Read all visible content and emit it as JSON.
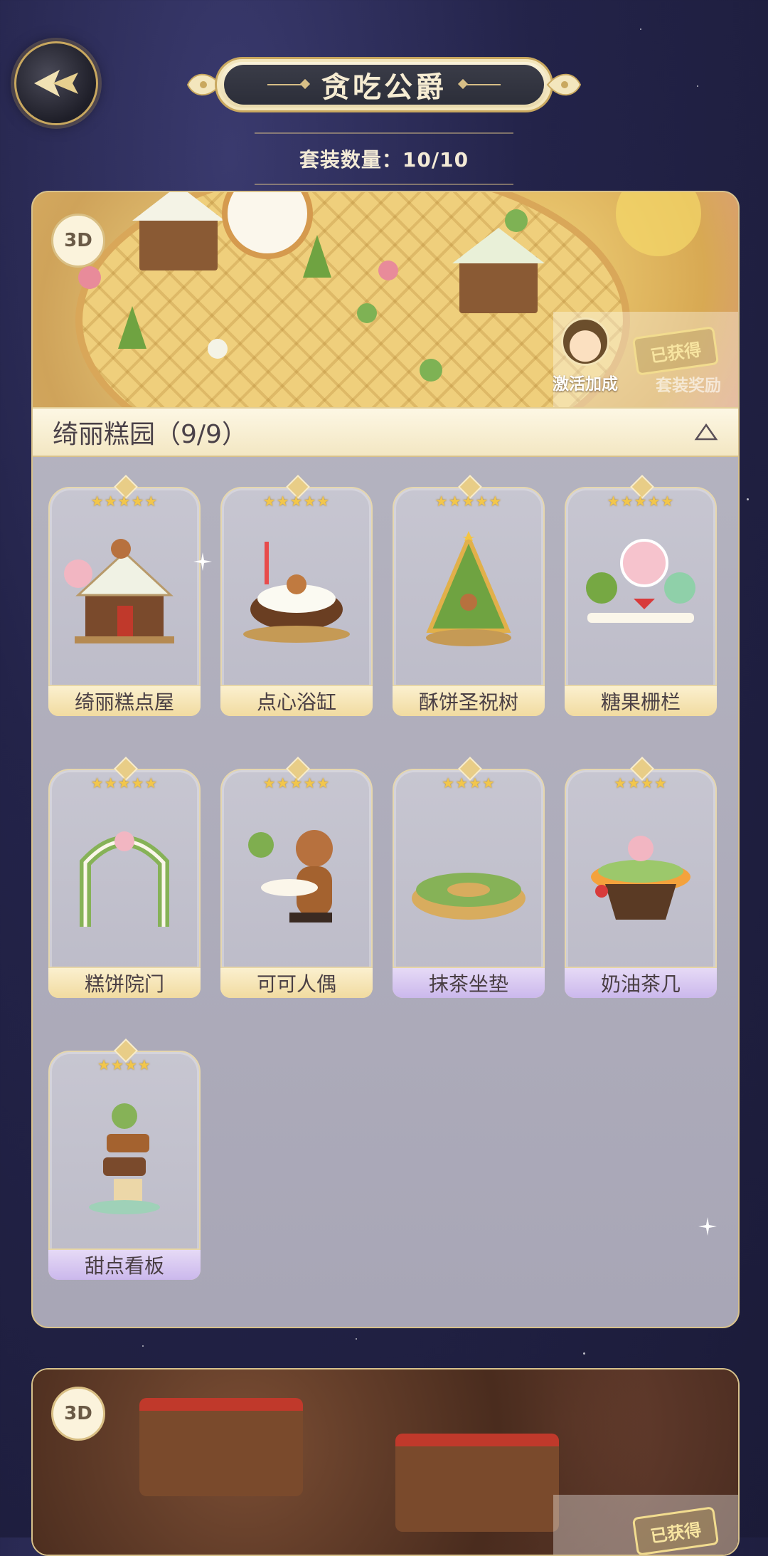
{
  "header": {
    "back_label": "",
    "title": "贪吃公爵",
    "set_count": "套装数量：10/10"
  },
  "suits": [
    {
      "badge": "3D",
      "activate_label": "激活加成",
      "obtained_label": "已获得",
      "reward_label": "套装奖励",
      "name": "绮丽糕园（9/9）",
      "items": [
        {
          "name": "绮丽糕点屋",
          "stars": "★★★★★",
          "rarity": "gold"
        },
        {
          "name": "点心浴缸",
          "stars": "★★★★★",
          "rarity": "gold"
        },
        {
          "name": "酥饼圣祝树",
          "stars": "★★★★★",
          "rarity": "gold"
        },
        {
          "name": "糖果栅栏",
          "stars": "★★★★★",
          "rarity": "gold"
        },
        {
          "name": "糕饼院门",
          "stars": "★★★★★",
          "rarity": "gold"
        },
        {
          "name": "可可人偶",
          "stars": "★★★★★",
          "rarity": "gold"
        },
        {
          "name": "抹茶坐垫",
          "stars": "★★★★",
          "rarity": "purple"
        },
        {
          "name": "奶油茶几",
          "stars": "★★★★",
          "rarity": "purple"
        },
        {
          "name": "甜点看板",
          "stars": "★★★★",
          "rarity": "purple"
        }
      ]
    },
    {
      "badge": "3D",
      "obtained_label": "已获得"
    }
  ],
  "colors": {
    "background": "#232349",
    "card_panel": "#b7b6c2",
    "gold_label": "#f1dba0",
    "purple_label": "#cbb8ec",
    "accent_gold": "#d8c28c"
  }
}
